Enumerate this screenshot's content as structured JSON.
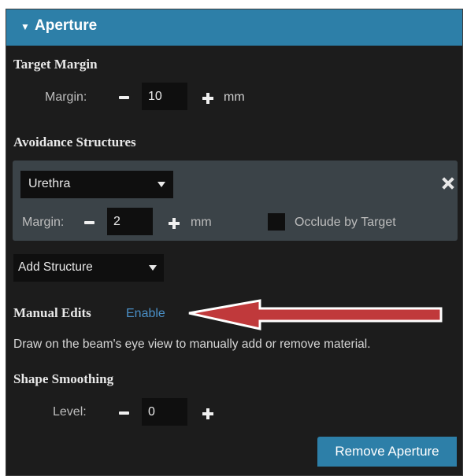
{
  "panel": {
    "title": "Aperture",
    "collapse_icon": "triangle-down-icon",
    "colors": {
      "header": "#2d7fa8",
      "background": "#1c1c1c",
      "group": "#3b4348",
      "link": "#4a8fc6",
      "arrow": "#c0393b"
    }
  },
  "target_margin": {
    "heading": "Target Margin",
    "label": "Margin:",
    "value": "10",
    "unit": "mm"
  },
  "avoidance": {
    "heading": "Avoidance Structures",
    "structure": {
      "selected": "Urethra",
      "margin_label": "Margin:",
      "margin_value": "2",
      "unit": "mm",
      "occlude_label": "Occlude by Target"
    },
    "add_label": "Add Structure"
  },
  "manual_edits": {
    "heading": "Manual Edits",
    "enable_label": "Enable",
    "description": "Draw on the beam's eye view to manually add or remove material."
  },
  "shape_smoothing": {
    "heading": "Shape Smoothing",
    "label": "Level:",
    "value": "0"
  },
  "remove_button": "Remove Aperture"
}
